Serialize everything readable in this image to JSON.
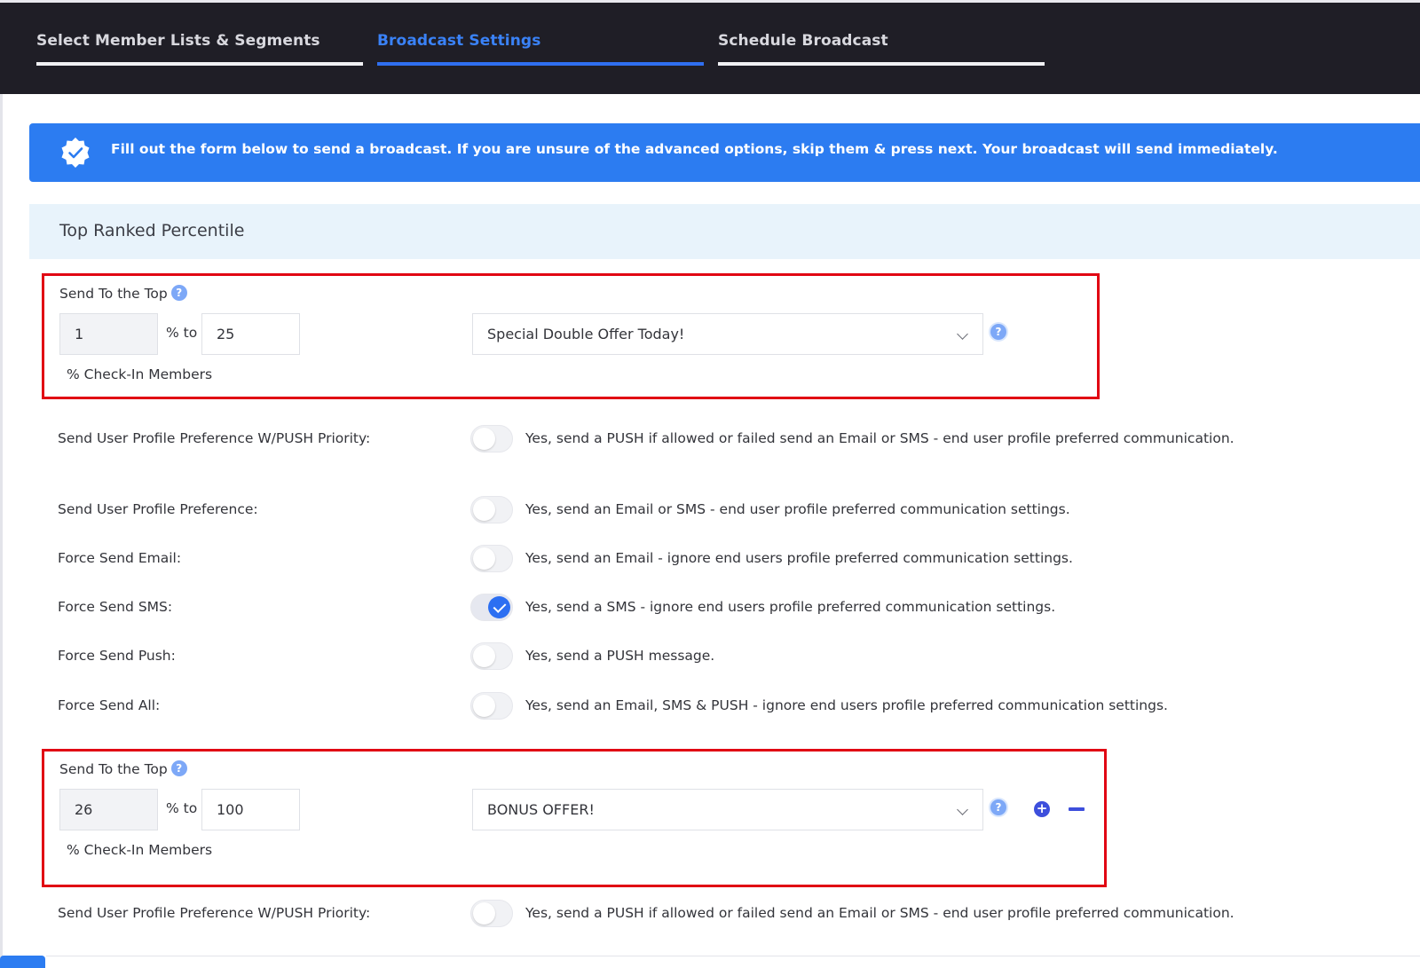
{
  "tabs": [
    {
      "label": "Select Member Lists & Segments",
      "active": false
    },
    {
      "label": "Broadcast Settings",
      "active": true
    },
    {
      "label": "Schedule Broadcast",
      "active": false
    }
  ],
  "banner": {
    "icon": "check-badge-icon",
    "text": "Fill out the form below to send a broadcast. If you are unsure of the advanced options, skip them & press next. Your broadcast will send immediately."
  },
  "section": {
    "title": "Top Ranked Percentile"
  },
  "tiers": [
    {
      "label": "Send To the Top",
      "help_icon": "?",
      "from": "1",
      "to_label": "% to",
      "to": "25",
      "members_label": "% Check-In Members",
      "offer": "Special Double Offer Today!"
    },
    {
      "label": "Send To the Top",
      "help_icon": "?",
      "from": "26",
      "to_label": "% to",
      "to": "100",
      "members_label": "% Check-In Members",
      "offer": "BONUS OFFER!",
      "add_icon": "+"
    }
  ],
  "options": [
    {
      "label": "Send User Profile Preference W/PUSH Priority:",
      "checked": false,
      "desc": "Yes, send a PUSH if allowed or failed send an Email or SMS - end user profile preferred communication."
    },
    {
      "label": "Send User Profile Preference:",
      "checked": false,
      "desc": "Yes, send an Email or SMS - end user profile preferred communication settings."
    },
    {
      "label": "Force Send Email:",
      "checked": false,
      "desc": "Yes, send an Email - ignore end users profile preferred communication settings."
    },
    {
      "label": "Force Send SMS:",
      "checked": true,
      "desc": "Yes, send a SMS - ignore end users profile preferred communication settings."
    },
    {
      "label": "Force Send Push:",
      "checked": false,
      "desc": "Yes, send a PUSH message."
    },
    {
      "label": "Force Send All:",
      "checked": false,
      "desc": "Yes, send an Email, SMS & PUSH - ignore end users profile preferred communication settings."
    },
    {
      "label": "Send User Profile Preference W/PUSH Priority:",
      "checked": false,
      "desc": "Yes, send a PUSH if allowed or failed send an Email or SMS - end user profile preferred communication."
    }
  ],
  "colors": {
    "accent": "#2c7cf1",
    "highlight_border": "#e10613",
    "header_bg": "#1f1e26"
  }
}
